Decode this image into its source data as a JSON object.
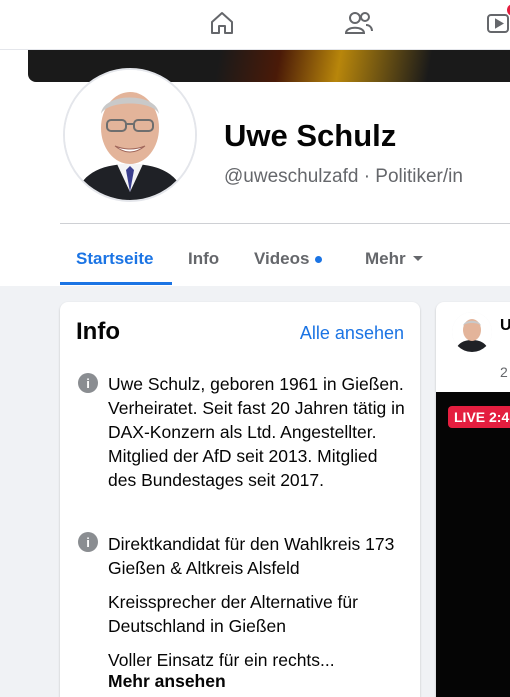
{
  "nav": {
    "items": [
      {
        "name": "home",
        "icon": "home-icon"
      },
      {
        "name": "friends",
        "icon": "friends-icon"
      },
      {
        "name": "watch",
        "icon": "watch-icon"
      }
    ]
  },
  "profile": {
    "name": "Uwe Schulz",
    "handle_line": "@uweschulzafd · Politiker/in"
  },
  "tabs": {
    "home": "Startseite",
    "info": "Info",
    "videos": "Videos",
    "more": "Mehr"
  },
  "info_card": {
    "title": "Info",
    "see_all": "Alle ansehen",
    "bio": "Uwe Schulz, geboren 1961 in Gießen. Verheiratet. Seit fast 20 Jahren tätig in DAX-Konzern als Ltd. Angestellter. Mitglied der AfD seit 2013. Mitglied des Bundestages seit 2017.",
    "candidate": "Direktkandidat für den Wahlkreis 173 Gießen & Altkreis Alsfeld",
    "speaker": "Kreissprecher der Alternative für Deutschland in Gießen",
    "teaser": "Voller Einsatz für ein rechts...",
    "more_label": "Mehr ansehen"
  },
  "post": {
    "author_partial": "U B",
    "time_partial": "2",
    "live_badge": "LIVE 2:4"
  },
  "colors": {
    "accent": "#1b74e4",
    "live": "#e41e3f",
    "background": "#f0f2f5"
  }
}
